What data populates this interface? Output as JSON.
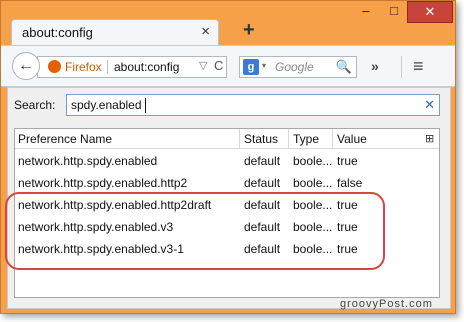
{
  "window": {
    "tab_title": "about:config",
    "tab_close": "×",
    "new_tab": "+",
    "minimize": "–",
    "maximize": "□",
    "close": "✕"
  },
  "navbar": {
    "back": "←",
    "identity": "Firefox",
    "url": "about:config",
    "url_dropdown": "▽",
    "reload": "C",
    "search_engine": "g",
    "search_dropdown": "▾",
    "search_placeholder": "Google",
    "search_button": "🔍",
    "overflow": "»",
    "menu": "≡"
  },
  "filter": {
    "label": "Search:",
    "value": "spdy.enabled",
    "clear": "✕"
  },
  "columns": [
    "Preference Name",
    "Status",
    "Type",
    "Value"
  ],
  "column_picker": "⊞",
  "rows": [
    {
      "name": "network.http.spdy.enabled",
      "status": "default",
      "type": "boole...",
      "value": "true"
    },
    {
      "name": "network.http.spdy.enabled.http2",
      "status": "default",
      "type": "boole...",
      "value": "false"
    },
    {
      "name": "network.http.spdy.enabled.http2draft",
      "status": "default",
      "type": "boole...",
      "value": "true"
    },
    {
      "name": "network.http.spdy.enabled.v3",
      "status": "default",
      "type": "boole...",
      "value": "true"
    },
    {
      "name": "network.http.spdy.enabled.v3-1",
      "status": "default",
      "type": "boole...",
      "value": "true"
    }
  ],
  "colors": {
    "frame": "#f6a14a",
    "close_button": "#c8443b",
    "annotation": "#d9453f"
  },
  "watermark": "groovyPost.com"
}
